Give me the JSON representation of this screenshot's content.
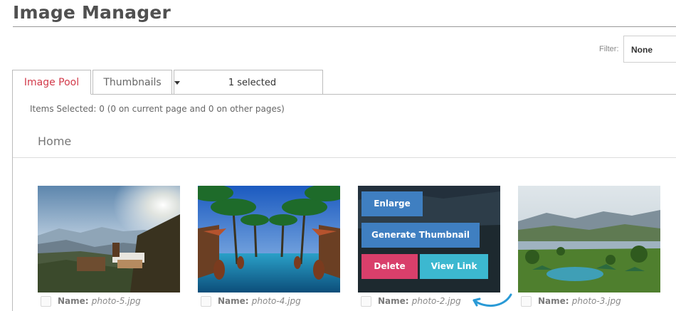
{
  "header": {
    "title": "Image Manager"
  },
  "filter": {
    "label": "Filter:",
    "value": "None"
  },
  "tabs": [
    {
      "label": "Image Pool",
      "active": true
    },
    {
      "label": "Thumbnails",
      "active": false
    }
  ],
  "selection_dropdown": {
    "value": "1 selected"
  },
  "status": {
    "items_selected": "Items Selected: 0 (0 on current page and 0 on other pages)"
  },
  "breadcrumb": {
    "home": "Home"
  },
  "images": [
    {
      "name_label": "Name:",
      "file": "photo-5.jpg"
    },
    {
      "name_label": "Name:",
      "file": "photo-4.jpg"
    },
    {
      "name_label": "Name:",
      "file": "photo-2.jpg"
    },
    {
      "name_label": "Name:",
      "file": "photo-3.jpg"
    }
  ],
  "hover_actions": {
    "enlarge": "Enlarge",
    "generate_thumbnail": "Generate Thumbnail",
    "delete": "Delete",
    "view_link": "View Link"
  },
  "colors": {
    "active_tab": "#d23a4a",
    "primary_button": "#3f7fc1",
    "delete_button": "#d93f6b",
    "view_link_button": "#3cb8d0",
    "arrow": "#2a9ad6"
  }
}
